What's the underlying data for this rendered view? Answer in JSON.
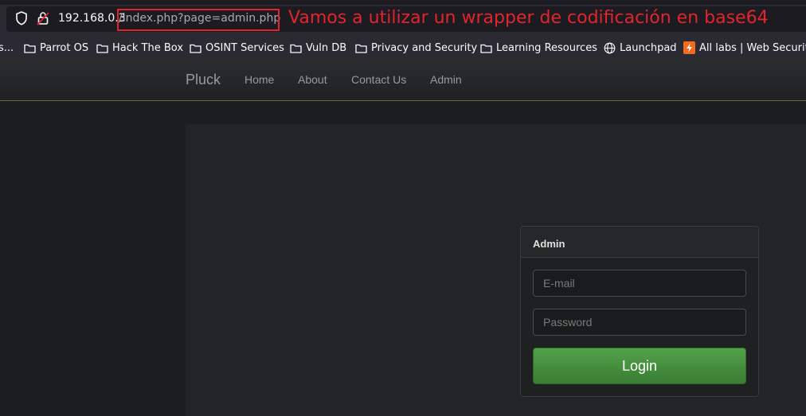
{
  "browser": {
    "url_host": "192.168.0.3",
    "url_path": "/index.php?page=admin.php",
    "annotation": "Vamos a utilizar un wrapper de codificación en base64"
  },
  "bookmarks": [
    {
      "label": "s...",
      "icon": "none"
    },
    {
      "label": "Parrot OS",
      "icon": "folder-icon"
    },
    {
      "label": "Hack The Box",
      "icon": "folder-icon"
    },
    {
      "label": "OSINT Services",
      "icon": "folder-icon"
    },
    {
      "label": "Vuln DB",
      "icon": "folder-icon"
    },
    {
      "label": "Privacy and Security",
      "icon": "folder-icon"
    },
    {
      "label": "Learning Resources",
      "icon": "folder-icon"
    },
    {
      "label": "Launchpad",
      "icon": "globe-icon"
    },
    {
      "label": "All labs | Web Securit",
      "icon": "lightning-icon"
    }
  ],
  "site": {
    "brand": "Pluck",
    "nav": [
      "Home",
      "About",
      "Contact Us",
      "Admin"
    ]
  },
  "login": {
    "title": "Admin",
    "email_placeholder": "E-mail",
    "password_placeholder": "Password",
    "button_label": "Login"
  },
  "colors": {
    "annotation": "#e3242b",
    "login_button": "#43893c"
  }
}
